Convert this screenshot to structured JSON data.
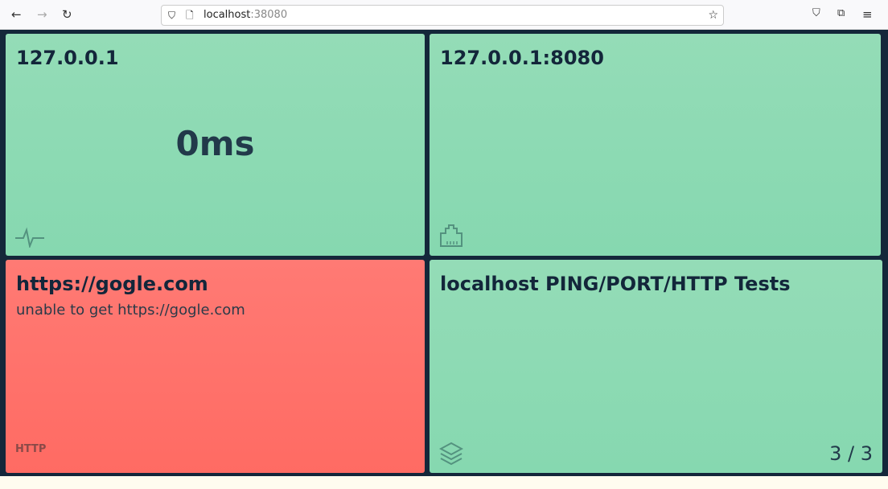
{
  "browser": {
    "url_host": "localhost",
    "url_port": ":38080"
  },
  "tiles": [
    {
      "title": "127.0.0.1",
      "value": "0ms",
      "icon": "pulse-icon",
      "status": "up"
    },
    {
      "title": "127.0.0.1:8080",
      "icon": "ethernet-port-icon",
      "status": "up"
    },
    {
      "title": "https://gogle.com",
      "message": "unable to get https://gogle.com",
      "type": "HTTP",
      "status": "down"
    },
    {
      "title": "localhost PING/PORT/HTTP Tests",
      "icon": "layers-icon",
      "count": "3 / 3",
      "status": "up"
    }
  ],
  "colors": {
    "up": "#8ddab4",
    "down": "#ff736b",
    "background": "#14273a"
  }
}
